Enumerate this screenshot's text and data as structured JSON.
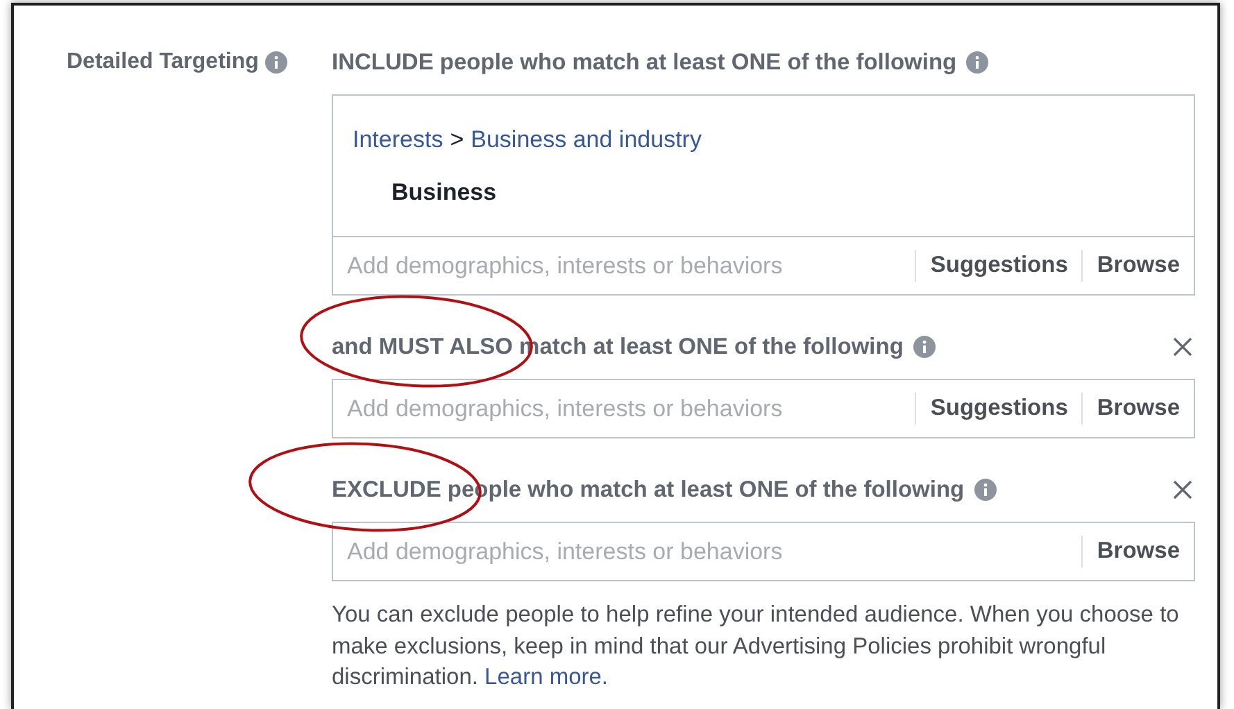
{
  "field_label": "Detailed Targeting",
  "sections": [
    {
      "heading": "INCLUDE people who match at least ONE of the following",
      "removable": false,
      "selection": {
        "path": [
          {
            "label": "Interests",
            "kind": "link"
          },
          {
            "label": ">",
            "kind": "separator"
          },
          {
            "label": "Business and industry",
            "kind": "link"
          }
        ],
        "items": [
          "Business"
        ]
      },
      "placeholder": "Add demographics, interests or behaviors",
      "actions": [
        "Suggestions",
        "Browse"
      ]
    },
    {
      "heading": "and MUST ALSO match at least ONE of the following",
      "removable": true,
      "placeholder": "Add demographics, interests or behaviors",
      "actions": [
        "Suggestions",
        "Browse"
      ]
    },
    {
      "heading": "EXCLUDE people who match at least ONE of the following",
      "removable": true,
      "placeholder": "Add demographics, interests or behaviors",
      "actions": [
        "Browse"
      ]
    }
  ],
  "note": {
    "text": "You can exclude people to help refine your intended audience. When you choose to make exclusions, keep in mind that our Advertising Policies prohibit wrongful discrimination.",
    "link": "Learn more."
  }
}
